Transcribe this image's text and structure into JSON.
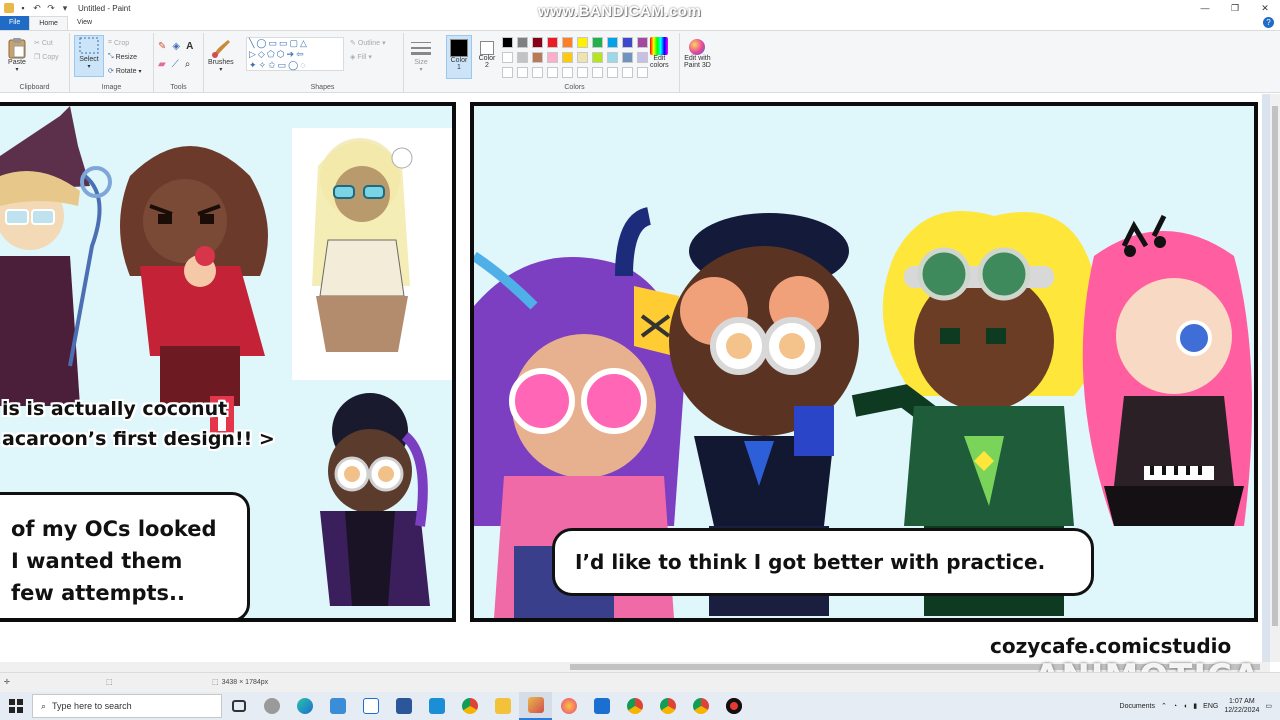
{
  "window": {
    "title": "Untitled - Paint",
    "controls": [
      "—",
      "❐",
      "✕"
    ]
  },
  "recorder_watermark": "www.BANDICAM.com",
  "menu": {
    "tabs": [
      "File",
      "Home",
      "View"
    ],
    "help": "?"
  },
  "ribbon": {
    "clipboard": {
      "label": "Clipboard",
      "paste": "Paste",
      "cut": "Cut",
      "copy": "Copy"
    },
    "image": {
      "label": "Image",
      "select": "Select",
      "crop": "Crop",
      "resize": "Resize",
      "rotate": "Rotate"
    },
    "tools": {
      "label": "Tools"
    },
    "brushes": {
      "label": "Brushes"
    },
    "shapes": {
      "label": "Shapes",
      "outline": "Outline",
      "fill": "Fill"
    },
    "size": {
      "label": "Size"
    },
    "color1": {
      "label": "Color",
      "sub": "1"
    },
    "color2": {
      "label": "Color",
      "sub": "2"
    },
    "colors": {
      "label": "Colors",
      "row1": [
        "#000000",
        "#7f7f7f",
        "#880015",
        "#ed1c24",
        "#ff7f27",
        "#fff200",
        "#22b14c",
        "#00a2e8",
        "#3f48cc",
        "#a349a4"
      ],
      "row2": [
        "#ffffff",
        "#c3c3c3",
        "#b97a57",
        "#ffaec9",
        "#ffc90e",
        "#efe4b0",
        "#b5e61d",
        "#99d9ea",
        "#7092be",
        "#c8bfe7"
      ]
    },
    "edit_colors": {
      "line1": "Edit",
      "line2": "colors"
    },
    "paint3d": {
      "line1": "Edit with",
      "line2": "Paint 3D"
    }
  },
  "comic": {
    "left_caption": {
      "line1": "is is actually coconut",
      "line2": "acaroon’s first design!! >"
    },
    "left_bubble": {
      "line1": "of my OCs looked",
      "line2": "I wanted them",
      "line3": "few attempts.."
    },
    "right_bubble": "I’d like to think I got better with practice.",
    "credit": "cozycafe.comicstudio"
  },
  "video_watermark": "ANIMOTICA",
  "statusbar": {
    "dimensions": "3438 × 1784px"
  },
  "taskbar": {
    "search_placeholder": "Type here to search",
    "documents": "Documents",
    "language": "ENG",
    "time": "1:07 AM",
    "date": "12/22/2024"
  }
}
